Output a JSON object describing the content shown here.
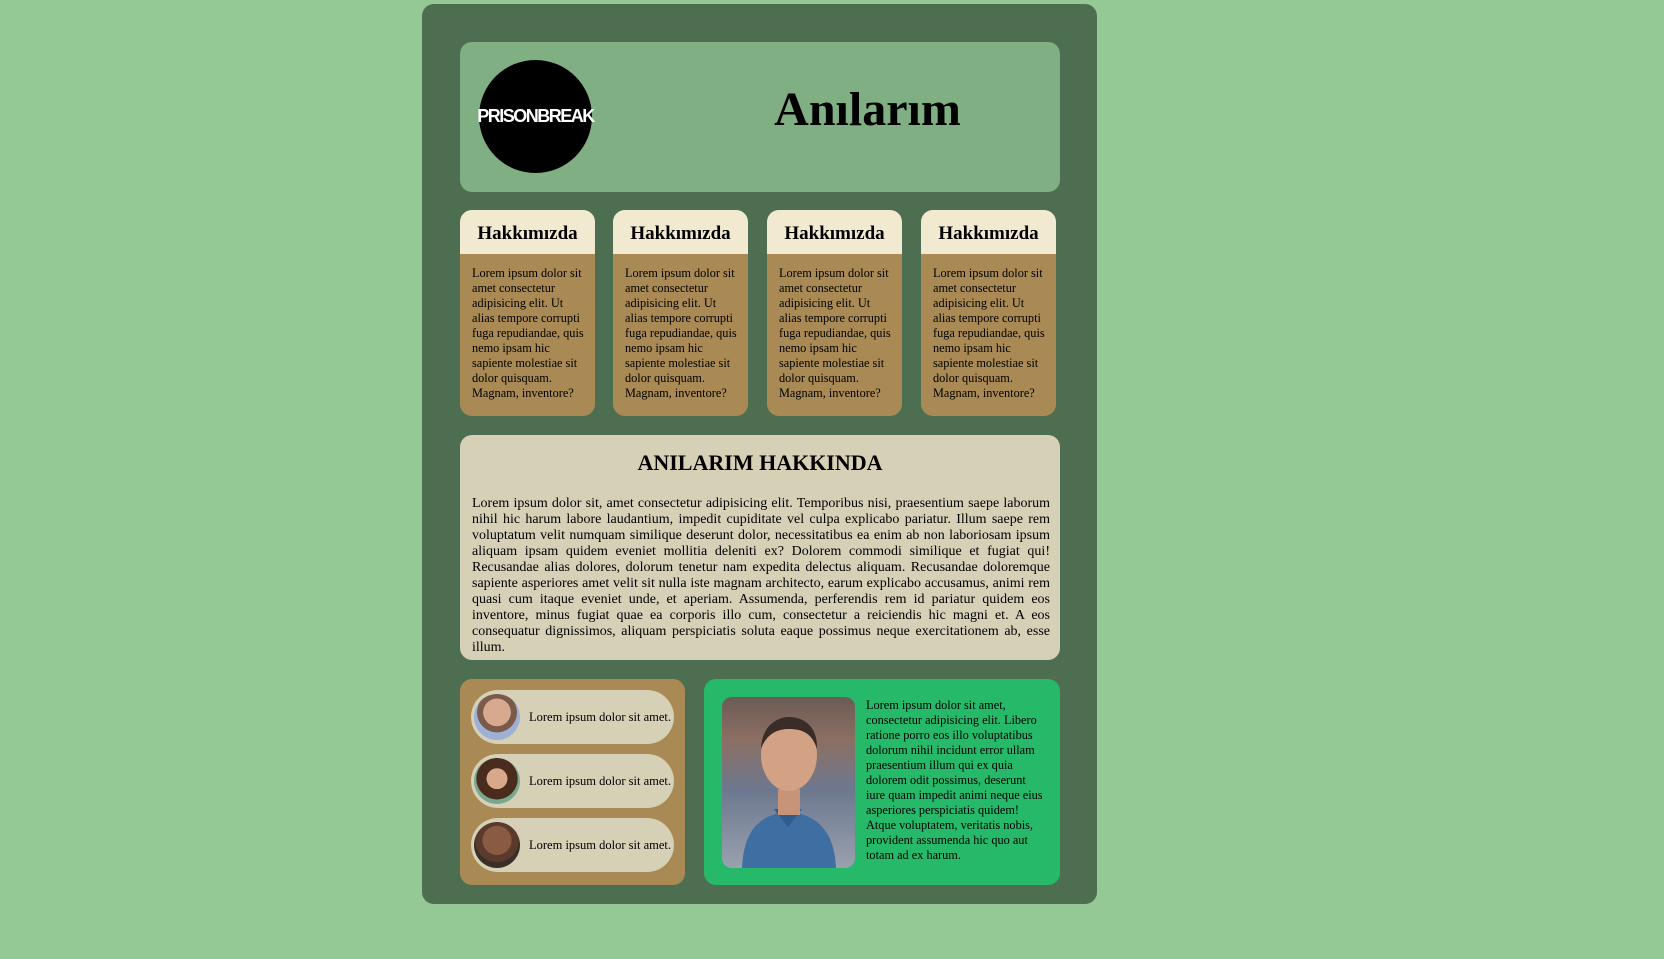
{
  "header": {
    "logo_text": "PRISONBREAK",
    "title": "Anılarım"
  },
  "cards": [
    {
      "title": "Hakkımızda",
      "text": "Lorem ipsum dolor sit amet consectetur adipisicing elit. Ut alias tempore corrupti fuga repudiandae, quis nemo ipsam hic sapiente molestiae sit dolor quisquam. Magnam, inventore?"
    },
    {
      "title": "Hakkımızda",
      "text": "Lorem ipsum dolor sit amet consectetur adipisicing elit. Ut alias tempore corrupti fuga repudiandae, quis nemo ipsam hic sapiente molestiae sit dolor quisquam. Magnam, inventore?"
    },
    {
      "title": "Hakkımızda",
      "text": "Lorem ipsum dolor sit amet consectetur adipisicing elit. Ut alias tempore corrupti fuga repudiandae, quis nemo ipsam hic sapiente molestiae sit dolor quisquam. Magnam, inventore?"
    },
    {
      "title": "Hakkımızda",
      "text": "Lorem ipsum dolor sit amet consectetur adipisicing elit. Ut alias tempore corrupti fuga repudiandae, quis nemo ipsam hic sapiente molestiae sit dolor quisquam. Magnam, inventore?"
    }
  ],
  "about": {
    "title": "ANILARIM HAKKINDA",
    "text": "Lorem ipsum dolor sit, amet consectetur adipisicing elit. Temporibus nisi, praesentium saepe laborum nihil hic harum labore laudantium, impedit cupiditate vel culpa explicabo pariatur. Illum saepe rem voluptatum velit numquam similique deserunt dolor, necessitatibus ea enim ab non laboriosam ipsum aliquam ipsam quidem eveniet mollitia deleniti ex? Dolorem commodi similique et fugiat qui! Recusandae alias dolores, dolorum tenetur nam expedita delectus aliquam. Recusandae doloremque sapiente asperiores amet velit sit nulla iste magnam architecto, earum explicabo accusamus, animi rem quasi cum itaque eveniet unde, et aperiam. Assumenda, perferendis rem id pariatur quidem eos inventore, minus fugiat quae ea corporis illo cum, consectetur a reiciendis hic magni et. A eos consequatur dignissimos, aliquam perspiciatis soluta eaque possimus neque exercitationem ab, esse illum."
  },
  "people": [
    {
      "text": "Lorem ipsum dolor sit amet."
    },
    {
      "text": "Lorem ipsum dolor sit amet."
    },
    {
      "text": "Lorem ipsum dolor sit amet."
    }
  ],
  "feature": {
    "text": "Lorem ipsum dolor sit amet, consectetur adipisicing elit. Libero ratione porro eos illo voluptatibus dolorum nihil incidunt error ullam praesentium illum qui ex quia dolorem odit possimus, deserunt iure quam impedit animi neque eius asperiores perspiciatis quidem! Atque voluptatem, veritatis nobis, provident assumenda hic quo aut totam ad ex harum."
  },
  "colors": {
    "page_bg": "#94c894",
    "container_bg": "#4d6e51",
    "header_bg": "#7faf83",
    "card_bg": "#a98a55",
    "card_head_bg": "#f1ead1",
    "about_bg": "#d5d0b6",
    "feature_bg": "#26b96a"
  }
}
